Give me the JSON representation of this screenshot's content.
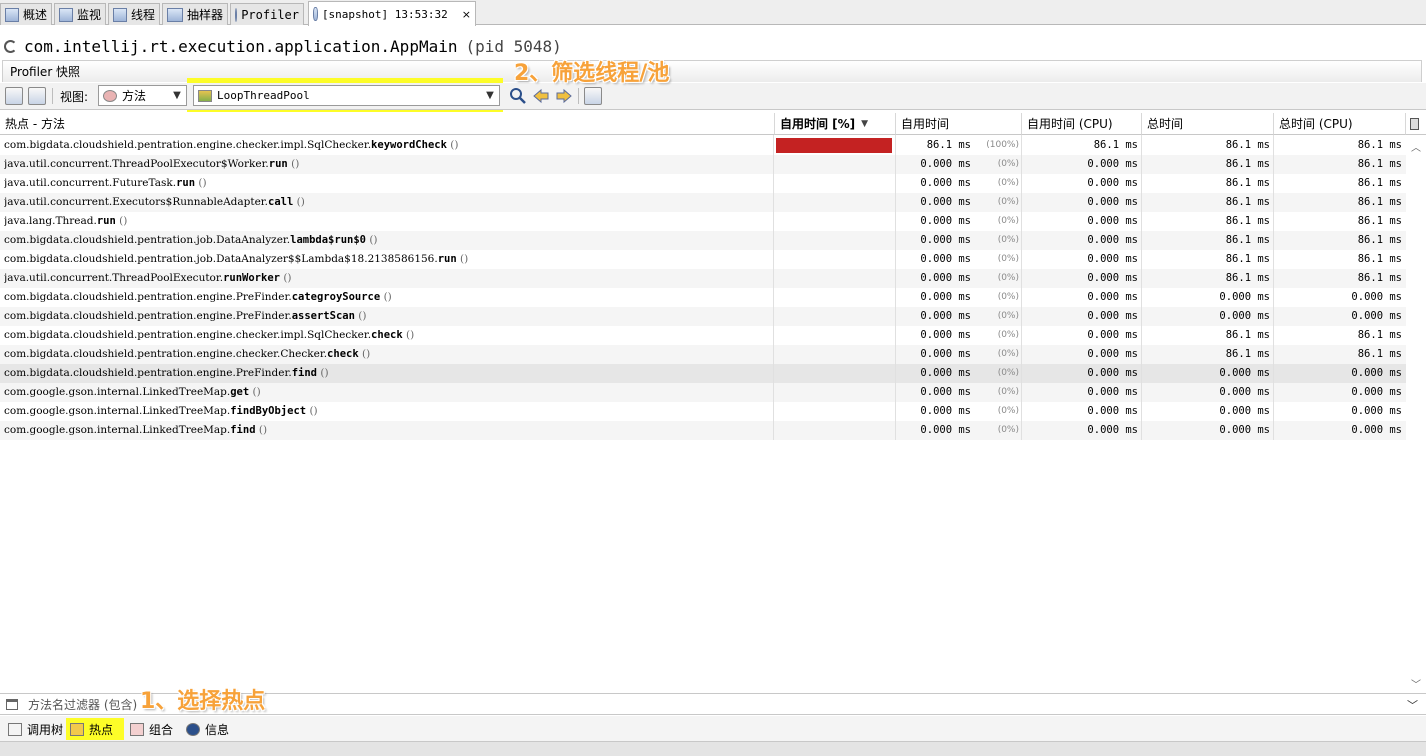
{
  "tabs": [
    {
      "label": "概述",
      "icon": "overview-icon"
    },
    {
      "label": "监视",
      "icon": "monitor-chart-icon"
    },
    {
      "label": "线程",
      "icon": "threads-icon"
    },
    {
      "label": "抽样器",
      "icon": "sampler-icon"
    },
    {
      "label": "Profiler",
      "icon": "profiler-clock-icon"
    },
    {
      "label": "[snapshot] 13:53:32",
      "icon": "snapshot-icon",
      "close": "×"
    }
  ],
  "process": {
    "title": "com.intellij.rt.execution.application.AppMain",
    "pid": "(pid 5048)"
  },
  "subheader": "Profiler 快照",
  "toolbar": {
    "view_label": "视图:",
    "view_value": "方法",
    "thread_value": "LoopThreadPool"
  },
  "annotations": {
    "step2": "2、筛选线程/池",
    "step1": "1、选择热点"
  },
  "table": {
    "headers": [
      "热点 - 方法",
      "自用时间 [%]",
      "自用时间",
      "自用时间 (CPU)",
      "总时间",
      "总时间 (CPU)"
    ],
    "sort_indicator": "▼",
    "rows": [
      {
        "pkg": "com.bigdata.cloudshield.pentration.engine.checker.impl.SqlChecker.",
        "method": "keywordCheck",
        "args": "()",
        "pct_fraction": 1.0,
        "self": "86.1 ms",
        "pct": "(100%)",
        "self_cpu": "86.1 ms",
        "total": "86.1 ms",
        "total_cpu": "86.1 ms"
      },
      {
        "pkg": "java.util.concurrent.ThreadPoolExecutor$Worker.",
        "method": "run",
        "args": "()",
        "pct_fraction": 0,
        "self": "0.000 ms",
        "pct": "(0%)",
        "self_cpu": "0.000 ms",
        "total": "86.1 ms",
        "total_cpu": "86.1 ms"
      },
      {
        "pkg": "java.util.concurrent.FutureTask.",
        "method": "run",
        "args": "()",
        "pct_fraction": 0,
        "self": "0.000 ms",
        "pct": "(0%)",
        "self_cpu": "0.000 ms",
        "total": "86.1 ms",
        "total_cpu": "86.1 ms"
      },
      {
        "pkg": "java.util.concurrent.Executors$RunnableAdapter.",
        "method": "call",
        "args": "()",
        "pct_fraction": 0,
        "self": "0.000 ms",
        "pct": "(0%)",
        "self_cpu": "0.000 ms",
        "total": "86.1 ms",
        "total_cpu": "86.1 ms"
      },
      {
        "pkg": "java.lang.Thread.",
        "method": "run",
        "args": "()",
        "pct_fraction": 0,
        "self": "0.000 ms",
        "pct": "(0%)",
        "self_cpu": "0.000 ms",
        "total": "86.1 ms",
        "total_cpu": "86.1 ms"
      },
      {
        "pkg": "com.bigdata.cloudshield.pentration.job.DataAnalyzer.",
        "method": "lambda$run$0",
        "args": "()",
        "pct_fraction": 0,
        "self": "0.000 ms",
        "pct": "(0%)",
        "self_cpu": "0.000 ms",
        "total": "86.1 ms",
        "total_cpu": "86.1 ms"
      },
      {
        "pkg": "com.bigdata.cloudshield.pentration.job.DataAnalyzer$$Lambda$18.2138586156.",
        "method": "run",
        "args": "()",
        "pct_fraction": 0,
        "self": "0.000 ms",
        "pct": "(0%)",
        "self_cpu": "0.000 ms",
        "total": "86.1 ms",
        "total_cpu": "86.1 ms"
      },
      {
        "pkg": "java.util.concurrent.ThreadPoolExecutor.",
        "method": "runWorker",
        "args": "()",
        "pct_fraction": 0,
        "self": "0.000 ms",
        "pct": "(0%)",
        "self_cpu": "0.000 ms",
        "total": "86.1 ms",
        "total_cpu": "86.1 ms"
      },
      {
        "pkg": "com.bigdata.cloudshield.pentration.engine.PreFinder.",
        "method": "categroySource",
        "args": "()",
        "pct_fraction": 0,
        "self": "0.000 ms",
        "pct": "(0%)",
        "self_cpu": "0.000 ms",
        "total": "0.000 ms",
        "total_cpu": "0.000 ms"
      },
      {
        "pkg": "com.bigdata.cloudshield.pentration.engine.PreFinder.",
        "method": "assertScan",
        "args": "()",
        "pct_fraction": 0,
        "self": "0.000 ms",
        "pct": "(0%)",
        "self_cpu": "0.000 ms",
        "total": "0.000 ms",
        "total_cpu": "0.000 ms"
      },
      {
        "pkg": "com.bigdata.cloudshield.pentration.engine.checker.impl.SqlChecker.",
        "method": "check",
        "args": "()",
        "pct_fraction": 0,
        "self": "0.000 ms",
        "pct": "(0%)",
        "self_cpu": "0.000 ms",
        "total": "86.1 ms",
        "total_cpu": "86.1 ms"
      },
      {
        "pkg": "com.bigdata.cloudshield.pentration.engine.checker.Checker.",
        "method": "check",
        "args": "()",
        "pct_fraction": 0,
        "self": "0.000 ms",
        "pct": "(0%)",
        "self_cpu": "0.000 ms",
        "total": "86.1 ms",
        "total_cpu": "86.1 ms"
      },
      {
        "pkg": "com.bigdata.cloudshield.pentration.engine.PreFinder.",
        "method": "find",
        "args": "()",
        "pct_fraction": 0,
        "self": "0.000 ms",
        "pct": "(0%)",
        "self_cpu": "0.000 ms",
        "total": "0.000 ms",
        "total_cpu": "0.000 ms",
        "selected": true
      },
      {
        "pkg": "com.google.gson.internal.LinkedTreeMap.",
        "method": "get",
        "args": "()",
        "pct_fraction": 0,
        "self": "0.000 ms",
        "pct": "(0%)",
        "self_cpu": "0.000 ms",
        "total": "0.000 ms",
        "total_cpu": "0.000 ms"
      },
      {
        "pkg": "com.google.gson.internal.LinkedTreeMap.",
        "method": "findByObject",
        "args": "()",
        "pct_fraction": 0,
        "self": "0.000 ms",
        "pct": "(0%)",
        "self_cpu": "0.000 ms",
        "total": "0.000 ms",
        "total_cpu": "0.000 ms"
      },
      {
        "pkg": "com.google.gson.internal.LinkedTreeMap.",
        "method": "find",
        "args": "()",
        "pct_fraction": 0,
        "self": "0.000 ms",
        "pct": "(0%)",
        "self_cpu": "0.000 ms",
        "total": "0.000 ms",
        "total_cpu": "0.000 ms"
      }
    ]
  },
  "filter": {
    "placeholder": "方法名过滤器 (包含)"
  },
  "bottom_tabs": [
    {
      "label": "调用树",
      "icon": "call-tree-icon"
    },
    {
      "label": "热点",
      "icon": "hotspots-icon",
      "highlighted": true
    },
    {
      "label": "组合",
      "icon": "combined-icon"
    },
    {
      "label": "信息",
      "icon": "info-icon"
    }
  ],
  "colors": {
    "bar": "#c42222",
    "highlight": "#fdfd28",
    "annotation": "#f7a23a"
  }
}
